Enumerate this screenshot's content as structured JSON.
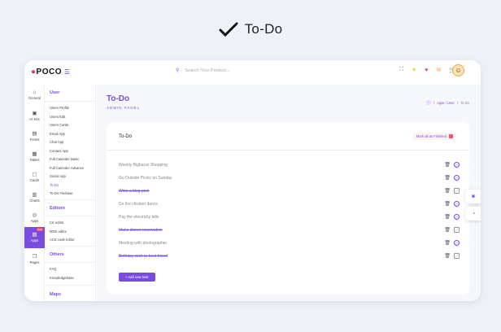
{
  "hero": {
    "title": "To-Do"
  },
  "topbar": {
    "logo": "POCO",
    "search_placeholder": "Search Your Product..."
  },
  "rail": [
    {
      "label": "General",
      "icon": "home-icon"
    },
    {
      "label": "UI Kits",
      "icon": "briefcase-icon"
    },
    {
      "label": "Forms",
      "icon": "forms-icon"
    },
    {
      "label": "Tables",
      "icon": "table-icon"
    },
    {
      "label": "Cards",
      "icon": "cards-icon"
    },
    {
      "label": "Charts",
      "icon": "chart-icon"
    },
    {
      "label": "Apps",
      "icon": "apps-icon"
    },
    {
      "label": "Apps",
      "icon": "apps-active-icon",
      "badge": "New"
    },
    {
      "label": "Pages",
      "icon": "pages-icon"
    }
  ],
  "submenu": {
    "user_head": "User",
    "user_items": [
      "Users Profile",
      "Users Edit",
      "Users Cards",
      "Email App",
      "Chat App",
      "Contact App",
      "Full Calender Basic",
      "Full Calender Advance",
      "Social App",
      "To-Do",
      "To-Do Firebase"
    ],
    "editors_head": "Editors",
    "editors_items": [
      "CK editor",
      "MDE editor",
      "ACE code editor"
    ],
    "others_head": "Others",
    "others_items": [
      "FAQ",
      "Knowledgebase"
    ],
    "maps_head": "Maps"
  },
  "page": {
    "title": "To-Do",
    "subtitle": "ADMIN PANEL",
    "breadcrumb": [
      "/",
      "Apps / User",
      "/",
      "To Do"
    ]
  },
  "card": {
    "title": "To-Do",
    "mark_all": "Mark all as Finished",
    "add_button": "Add new task",
    "add_icon": "+",
    "tasks": [
      {
        "text": "Weekly Bigbazar Shopping",
        "done": false
      },
      {
        "text": "Go Outside Picnic on Sunday",
        "done": false
      },
      {
        "text": "Write a blog post",
        "done": true
      },
      {
        "text": "Do the chicken dance",
        "done": false
      },
      {
        "text": "Pay the electricity bills",
        "done": false
      },
      {
        "text": "Make dinner reservation",
        "done": true
      },
      {
        "text": "Meeting with photographer",
        "done": false
      },
      {
        "text": "Birthday wish to best friend",
        "done": true
      }
    ]
  },
  "colors": {
    "accent": "#7a4be0",
    "danger": "#ff4d6d"
  }
}
